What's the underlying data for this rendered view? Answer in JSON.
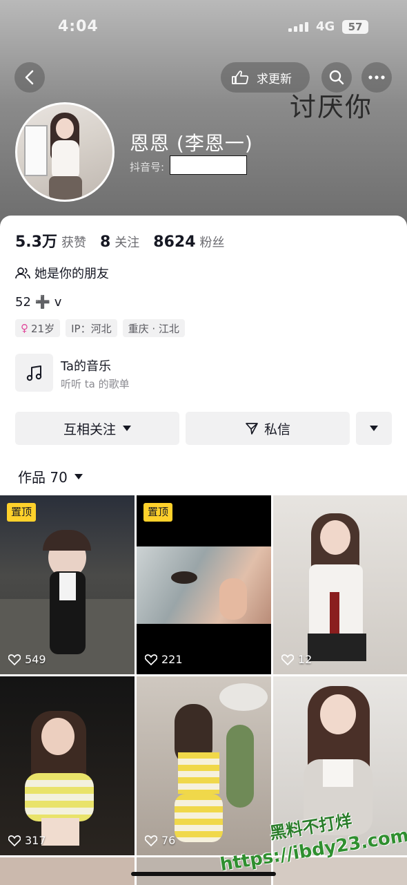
{
  "status_bar": {
    "time": "4:04",
    "network": "4G",
    "battery": "57"
  },
  "header": {
    "update_label": "求更新",
    "overlay_text": "讨厌你",
    "nickname": "恩恩 (李恩一)",
    "douyin_id_label": "抖音号:"
  },
  "stats": [
    {
      "value": "5.3万",
      "label": "获赞"
    },
    {
      "value": "8",
      "label": "关注"
    },
    {
      "value": "8624",
      "label": "粉丝"
    }
  ],
  "friend_text": "她是你的朋友",
  "bio": "52 ➕ v",
  "tags": [
    {
      "icon": "female-icon",
      "text": "21岁"
    },
    {
      "text": "IP：河北"
    },
    {
      "text": "重庆 · 江北"
    }
  ],
  "music": {
    "title": "Ta的音乐",
    "subtitle": "听听 ta 的歌单"
  },
  "actions": {
    "follow_label": "互相关注",
    "message_label": "私信"
  },
  "works_tab": "作品 70",
  "videos": [
    {
      "pinned": "置顶",
      "likes": "549"
    },
    {
      "pinned": "置顶",
      "likes": "221"
    },
    {
      "likes": "12"
    },
    {
      "likes": "317"
    },
    {
      "likes": "76"
    },
    {
      "likes": ""
    }
  ],
  "watermark": {
    "line1": "黑料不打烊",
    "line2": "https://ibdy23.com"
  },
  "colors": {
    "pin_badge": "#ffd12b",
    "watermark": "#2f8f2f",
    "female": "#e0469a"
  }
}
